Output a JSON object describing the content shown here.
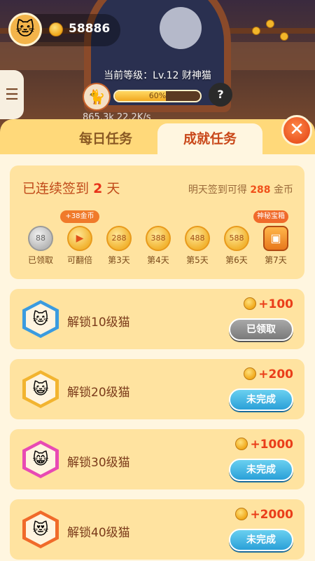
{
  "player": {
    "coins": "58886",
    "level_text": "当前等级：Lv.12 财神猫",
    "level_progress_label": "60%",
    "level_progress": 0.6,
    "stats_text": "865.3k      22.2K/s"
  },
  "tabs": {
    "daily": "每日任务",
    "achievement": "成就任务",
    "active": "achievement"
  },
  "signin": {
    "prefix": "已连续签到",
    "days": "2",
    "suffix": "天",
    "tomorrow_prefix": "明天签到可得",
    "tomorrow_amount": "288",
    "tomorrow_suffix": "金币",
    "items": [
      {
        "value": "88",
        "label": "已领取",
        "state": "claimed",
        "badge": ""
      },
      {
        "value": "▶",
        "label": "可翻倍",
        "state": "play",
        "badge": "+38金币"
      },
      {
        "value": "288",
        "label": "第3天",
        "state": "normal",
        "badge": ""
      },
      {
        "value": "388",
        "label": "第4天",
        "state": "normal",
        "badge": ""
      },
      {
        "value": "488",
        "label": "第5天",
        "state": "normal",
        "badge": ""
      },
      {
        "value": "588",
        "label": "第6天",
        "state": "normal",
        "badge": ""
      },
      {
        "value": "▣",
        "label": "第7天",
        "state": "chest",
        "badge": "神秘宝箱"
      }
    ]
  },
  "achievements": [
    {
      "title": "解锁10级猫",
      "reward": "+100",
      "button": "已领取",
      "status": "done",
      "hex_color": "#3a9be0",
      "icon": "cat-lucky-icon"
    },
    {
      "title": "解锁20级猫",
      "reward": "+200",
      "button": "未完成",
      "status": "pending",
      "hex_color": "#f2b430",
      "icon": "cat-gray-icon"
    },
    {
      "title": "解锁30级猫",
      "reward": "+1000",
      "button": "未完成",
      "status": "pending",
      "hex_color": "#e84ab4",
      "icon": "cat-bride-icon"
    },
    {
      "title": "解锁40级猫",
      "reward": "+2000",
      "button": "未完成",
      "status": "pending",
      "hex_color": "#f06a2a",
      "icon": "cat-fortune-icon"
    }
  ],
  "colors": {
    "sheet_bg": "#ffd97a",
    "card_bg": "#ffe3a0",
    "accent": "#e8341a"
  }
}
